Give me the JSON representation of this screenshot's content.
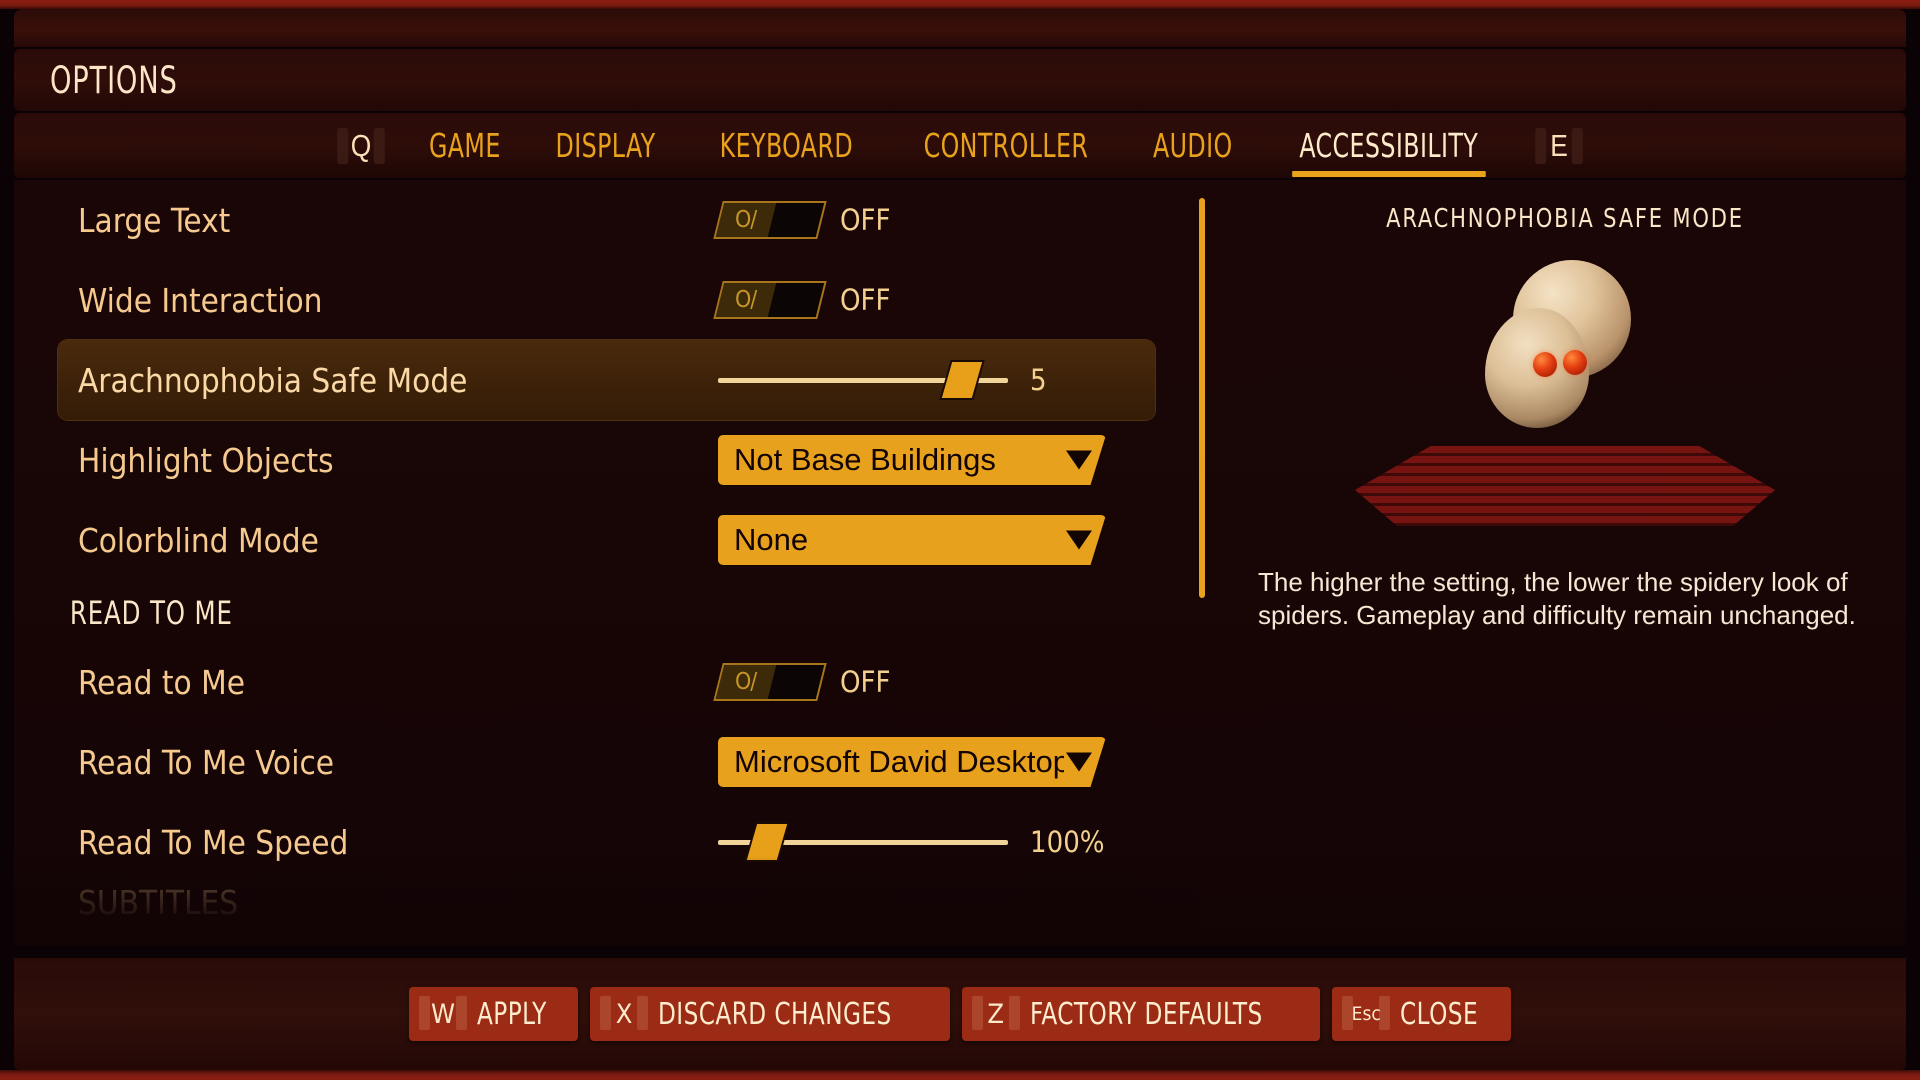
{
  "window": {
    "title": "OPTIONS",
    "accent_color": "#e9a21c",
    "red_accent_color": "#8c1e12"
  },
  "tabs": {
    "prev_key": "Q",
    "next_key": "E",
    "items": [
      {
        "label": "GAME",
        "active": false
      },
      {
        "label": "DISPLAY",
        "active": false
      },
      {
        "label": "KEYBOARD",
        "active": false
      },
      {
        "label": "CONTROLLER",
        "active": false
      },
      {
        "label": "AUDIO",
        "active": false
      },
      {
        "label": "ACCESSIBILITY",
        "active": true
      }
    ]
  },
  "settings": {
    "rows": [
      {
        "label": "Large Text",
        "type": "toggle",
        "value": "OFF",
        "knob": "O/"
      },
      {
        "label": "Wide Interaction",
        "type": "toggle",
        "value": "OFF",
        "knob": "O/"
      },
      {
        "label": "Arachnophobia Safe Mode",
        "type": "slider",
        "value": "5",
        "percent": 84,
        "selected": true
      },
      {
        "label": "Highlight Objects",
        "type": "dropdown",
        "value": "Not Base Buildings"
      },
      {
        "label": "Colorblind Mode",
        "type": "dropdown",
        "value": "None"
      }
    ],
    "section_read_to_me": {
      "heading": "READ TO ME",
      "rows": [
        {
          "label": "Read to Me",
          "type": "toggle",
          "value": "OFF",
          "knob": "O/"
        },
        {
          "label": "Read To Me Voice",
          "type": "dropdown",
          "value": "Microsoft David Desktop"
        },
        {
          "label": "Read To Me Speed",
          "type": "slider",
          "value": "100%",
          "percent": 17
        }
      ]
    },
    "clipped_next_section": "SUBTITLES"
  },
  "preview": {
    "title": "ARACHNOPHOBIA SAFE MODE",
    "description": "The higher the setting, the lower the spidery look of spiders. Gameplay and difficulty remain unchanged."
  },
  "footer": {
    "buttons": [
      {
        "key": "W",
        "label": "APPLY"
      },
      {
        "key": "X",
        "label": "DISCARD CHANGES"
      },
      {
        "key": "Z",
        "label": "FACTORY DEFAULTS"
      },
      {
        "key": "Esc",
        "label": "CLOSE"
      }
    ]
  }
}
